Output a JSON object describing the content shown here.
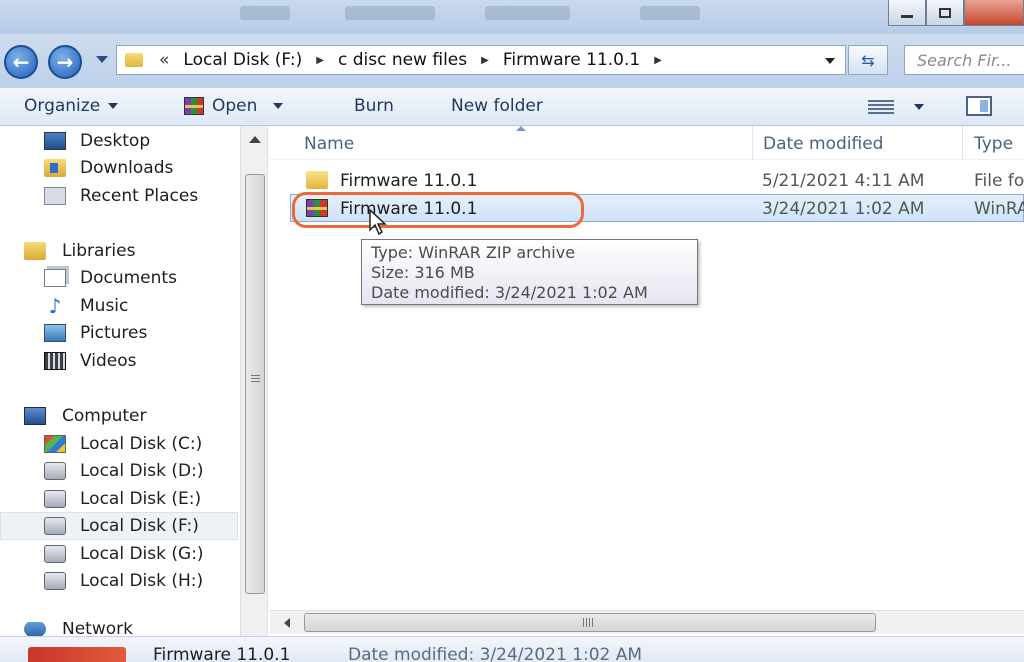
{
  "address_bar": {
    "crumb_prefix": "«",
    "crumbs": [
      "Local Disk (F:)",
      "c disc new files",
      "Firmware 11.0.1"
    ],
    "search_placeholder": "Search Fir..."
  },
  "toolbar": {
    "organize_label": "Organize",
    "open_label": "Open",
    "burn_label": "Burn",
    "new_folder_label": "New folder"
  },
  "nav_pane": {
    "favorites": [
      "Desktop",
      "Downloads",
      "Recent Places"
    ],
    "libraries_label": "Libraries",
    "libraries": [
      "Documents",
      "Music",
      "Pictures",
      "Videos"
    ],
    "computer_label": "Computer",
    "drives": [
      "Local Disk (C:)",
      "Local Disk (D:)",
      "Local Disk (E:)",
      "Local Disk (F:)",
      "Local Disk (G:)",
      "Local Disk (H:)"
    ],
    "selected_drive": "Local Disk (F:)",
    "network_label": "Network"
  },
  "file_list": {
    "columns": [
      "Name",
      "Date modified",
      "Type"
    ],
    "rows": [
      {
        "name": "Firmware 11.0.1",
        "date": "5/21/2021 4:11 AM",
        "type": "File fo",
        "icon": "folder-icon"
      },
      {
        "name": "Firmware 11.0.1",
        "date": "3/24/2021 1:02 AM",
        "type": "WinRA",
        "icon": "winrar-archive-icon",
        "selected": true
      }
    ]
  },
  "tooltip": {
    "type_line": "Type: WinRAR ZIP archive",
    "size_line": "Size: 316 MB",
    "date_line": "Date modified: 3/24/2021 1:02 AM"
  },
  "details_pane": {
    "name": "Firmware 11.0.1",
    "date_modified": "Date modified:  3/24/2021 1:02 AM"
  },
  "colors": {
    "highlight_ring": "#ec6a38",
    "selection": "#cfe2f8",
    "link_text": "#1e395b"
  }
}
